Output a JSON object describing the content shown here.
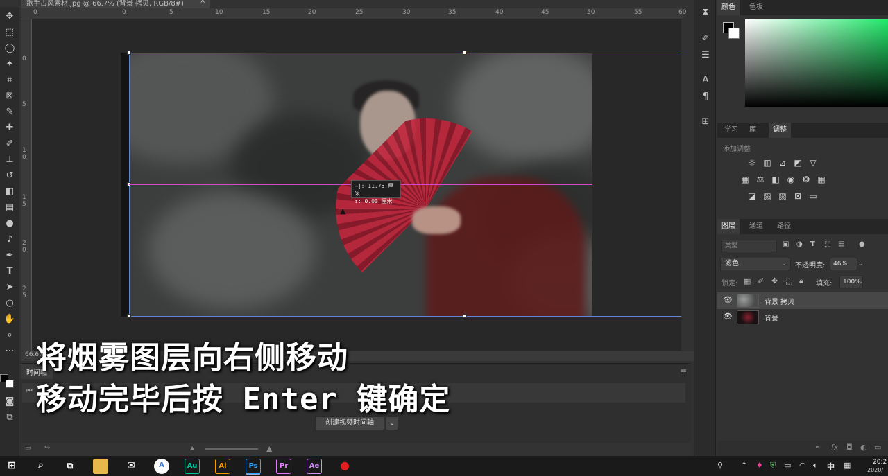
{
  "document": {
    "tab_title": "歌手古风素材.jpg @ 66.7% (背景 拷贝, RGB/8#)",
    "close_glyph": "×",
    "zoom": "66.67%"
  },
  "ruler": {
    "top_labels": [
      "0",
      "0",
      "5",
      "10",
      "15",
      "20",
      "25",
      "30",
      "35",
      "40",
      "45",
      "50",
      "55",
      "60"
    ],
    "left_labels": [
      "0",
      "5",
      "1 0",
      "1 5",
      "2 0",
      "2 5"
    ]
  },
  "measure_tooltip": {
    "line1": "→|: 11.75 厘米",
    "line2": "↕:   0.00 厘米"
  },
  "timeline": {
    "tab_label": "时间轴",
    "menu_glyph": "≡",
    "create_button": "创建视频时间轴",
    "dropdown_glyph": "⌄"
  },
  "subtitles": {
    "line1": "将烟雾图层向右侧移动",
    "line2": "移动完毕后按 Enter 键确定"
  },
  "panels": {
    "color_tabs": [
      "颜色",
      "色板"
    ],
    "adjust_tabs": [
      "学习",
      "库",
      "调整"
    ],
    "adjust_hint": "添加调整",
    "layer_tabs": [
      "图层",
      "通道",
      "路径"
    ],
    "filter_placeholder": "类型",
    "blend_mode": "滤色",
    "opacity_label": "不透明度:",
    "opacity_value": "46%",
    "lock_label": "锁定:",
    "fill_label": "填充:",
    "fill_value": "100%",
    "chevron": "⌄"
  },
  "layers": [
    {
      "name": "背景 拷贝",
      "visible": true,
      "selected": true
    },
    {
      "name": "背景",
      "visible": true,
      "selected": false
    }
  ],
  "taskbar": {
    "apps": [
      {
        "label": "Au",
        "color": "#00c8a0",
        "bg": "#0a3a33"
      },
      {
        "label": "Ai",
        "color": "#ff9a00",
        "bg": "#3b1f00"
      },
      {
        "label": "Ps",
        "color": "#31a8ff",
        "bg": "#001e36"
      },
      {
        "label": "Pr",
        "color": "#e77bff",
        "bg": "#2a0034"
      },
      {
        "label": "Ae",
        "color": "#d291ff",
        "bg": "#1f0040"
      }
    ],
    "ime": "中",
    "clock_time": "20:2",
    "clock_date": "2020/"
  },
  "colors": {
    "accent_guide": "#d34ad1",
    "bbox": "#5e86d8",
    "color_field_hue": "#23e86b"
  }
}
